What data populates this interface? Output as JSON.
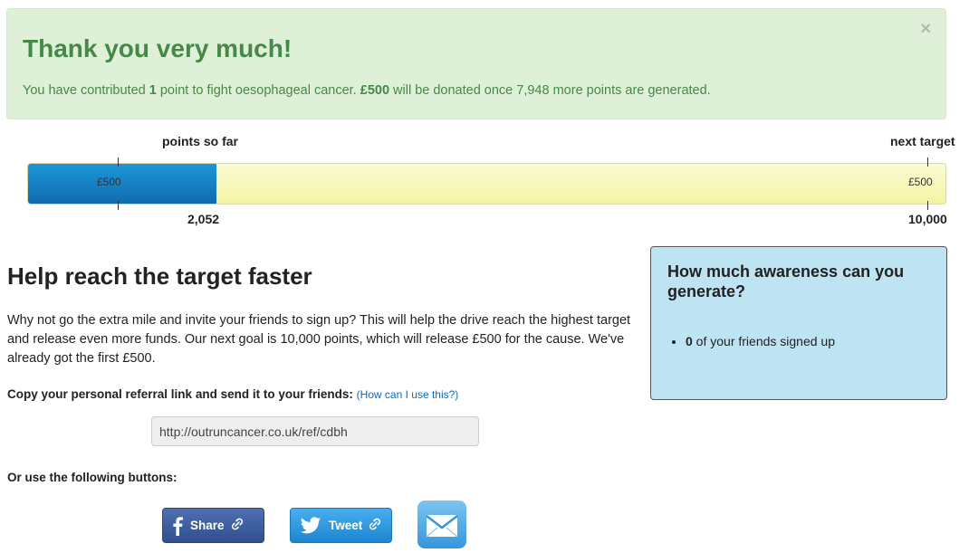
{
  "alert": {
    "close": "×",
    "title": "Thank you very much!",
    "msg_part1": "You have contributed ",
    "points": "1",
    "msg_part2": " point to fight oesophageal cancer. ",
    "amount": "£500",
    "msg_part3": " will be donated once 7,948 more points are generated."
  },
  "progress": {
    "label_left": "points so far",
    "label_right": "next target",
    "current_marker": "£500",
    "target_marker": "£500",
    "current_value": "2,052",
    "target_value": "10,000",
    "fraction": 0.2052,
    "fill_color": "#1a84c8",
    "track_color": "#f6f6b5"
  },
  "help": {
    "title": "Help reach the target faster",
    "description": "Why not go the extra mile and invite your friends to sign up? This will help the drive reach the highest target and release even more funds. Our next goal is 10,000 points, which will release £500 for the cause. We've already got the first £500.",
    "copy_label": "Copy your personal referral link and send it to your friends:",
    "how_link": "(How can I use this?)",
    "ref_link": "http://outruncancer.co.uk/ref/cdbh",
    "or_label": "Or use the following buttons:"
  },
  "buttons": {
    "facebook": {
      "label": "Share",
      "icon": "facebook-icon"
    },
    "twitter": {
      "label": "Tweet",
      "icon": "twitter-bird-icon"
    },
    "email": {
      "icon": "envelope-icon"
    }
  },
  "awareness": {
    "title": "How much awareness can you generate?",
    "count": "0",
    "count_text": " of your friends signed up"
  }
}
